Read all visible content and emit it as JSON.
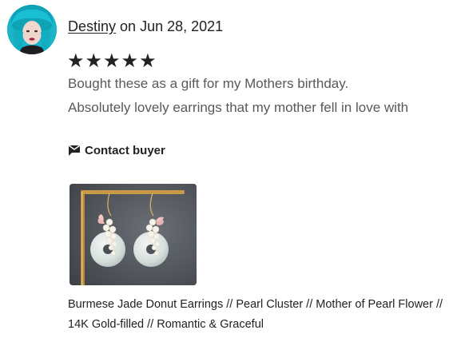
{
  "review": {
    "reviewer_name": "Destiny",
    "date_text": "on Jun 28, 2021",
    "stars_text": "★★★★★",
    "rating": 5,
    "rating_max": 5,
    "text_line_1": "Bought these as a gift for my Mothers birthday.",
    "text_line_2": "Absolutely lovely earrings that my mother fell in love with"
  },
  "contact": {
    "label": "Contact buyer",
    "icon": "message-icon"
  },
  "product": {
    "title": "Burmese Jade Donut Earrings // Pearl Cluster // Mother of Pearl Flower // 14K Gold-filled // Romantic & Graceful"
  },
  "colors": {
    "avatar_hair": "#1bb7c9",
    "text_primary": "#222222",
    "text_secondary": "#595959"
  }
}
